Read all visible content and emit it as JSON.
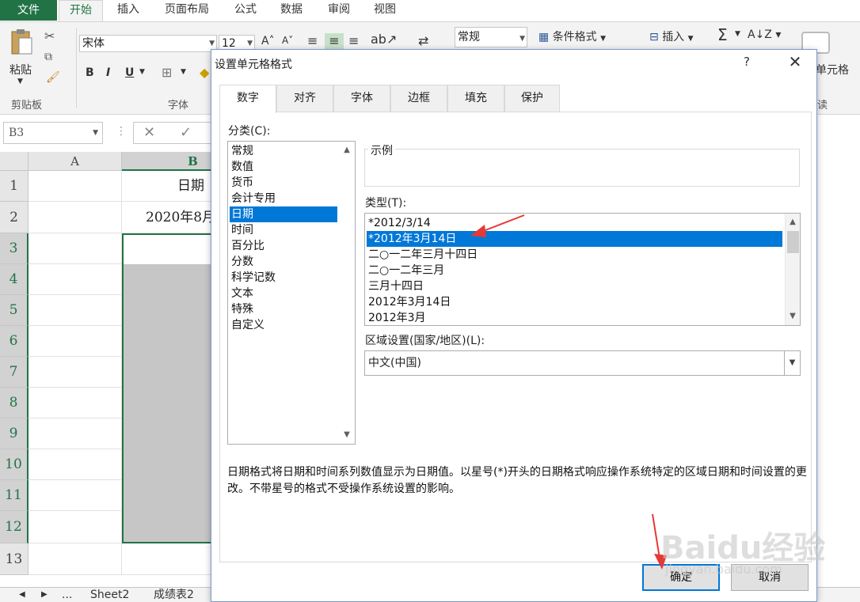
{
  "ribbon": {
    "file_tab": "文件",
    "tabs": [
      "开始",
      "插入",
      "页面布局",
      "公式",
      "数据",
      "审阅",
      "视图"
    ],
    "paste_label": "粘贴",
    "clipboard_label": "剪贴板",
    "font_name": "宋体",
    "font_size": "12",
    "font_group_label": "字体",
    "bold": "B",
    "italic": "I",
    "underline": "U",
    "number_format": "常规",
    "conditional_format": "条件格式",
    "insert": "插入",
    "sum_symbol": "Σ",
    "cell_format_partial": "单元格",
    "edit_partial": "读"
  },
  "formula_bar": {
    "name_box": "B3"
  },
  "grid": {
    "columns": [
      "A",
      "B"
    ],
    "rows": [
      "1",
      "2",
      "3",
      "4",
      "5",
      "6",
      "7",
      "8",
      "9",
      "10",
      "11",
      "12",
      "13"
    ],
    "b1": "日期",
    "b2": "2020年8月"
  },
  "sheets": {
    "sheet2": "Sheet2",
    "sheet3": "成绩表2"
  },
  "dialog": {
    "title": "设置单元格格式",
    "help": "?",
    "close": "✕",
    "tabs": [
      "数字",
      "对齐",
      "字体",
      "边框",
      "填充",
      "保护"
    ],
    "category_label": "分类(C):",
    "categories": [
      "常规",
      "数值",
      "货币",
      "会计专用",
      "日期",
      "时间",
      "百分比",
      "分数",
      "科学记数",
      "文本",
      "特殊",
      "自定义"
    ],
    "selected_category": "日期",
    "sample_label": "示例",
    "type_label": "类型(T):",
    "types": [
      "*2012/3/14",
      "*2012年3月14日",
      "二○一二年三月十四日",
      "二○一二年三月",
      "三月十四日",
      "2012年3月14日",
      "2012年3月"
    ],
    "selected_type": "*2012年3月14日",
    "locale_label": "区域设置(国家/地区)(L):",
    "locale_value": "中文(中国)",
    "description": "日期格式将日期和时间系列数值显示为日期值。以星号(*)开头的日期格式响应操作系统特定的区域日期和时间设置的更改。不带星号的格式不受操作系统设置的影响。",
    "ok": "确定",
    "cancel": "取消"
  },
  "watermark": {
    "main": "Baidu经验",
    "sub": "jingyan.baidu.com"
  },
  "colors": {
    "excel_green": "#217346",
    "selection_blue": "#0078d7",
    "annotation_red": "#e53935"
  }
}
